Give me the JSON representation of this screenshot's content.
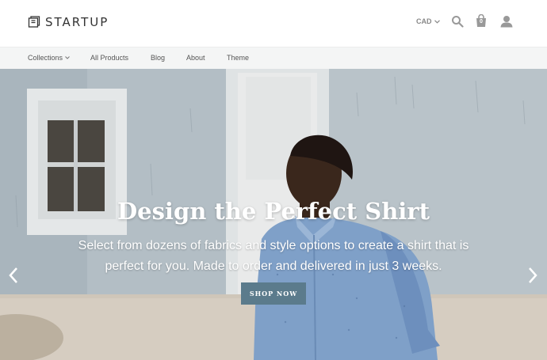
{
  "brand": {
    "name": "STARTUP"
  },
  "header": {
    "currency": "CAD",
    "cart_count": "0"
  },
  "nav": {
    "items": [
      {
        "label": "Collections"
      },
      {
        "label": "All Products"
      },
      {
        "label": "Blog"
      },
      {
        "label": "About"
      },
      {
        "label": "Theme"
      }
    ]
  },
  "hero": {
    "title": "Design the Perfect Shirt",
    "subtitle_line1": "Select from dozens of fabrics and style options to create a shirt that is",
    "subtitle_line2": "perfect for you. Made to order and delivered in just 3 weeks.",
    "cta": "SHOP NOW"
  },
  "icons": [
    "logo-icon",
    "chevron-down-icon",
    "search-icon",
    "shopping-bag-icon",
    "user-icon",
    "chevron-left-icon",
    "chevron-right-icon"
  ],
  "colors": {
    "cta": "#5b7b8c",
    "nav_bg": "#f4f5f5",
    "text": "#333333"
  }
}
